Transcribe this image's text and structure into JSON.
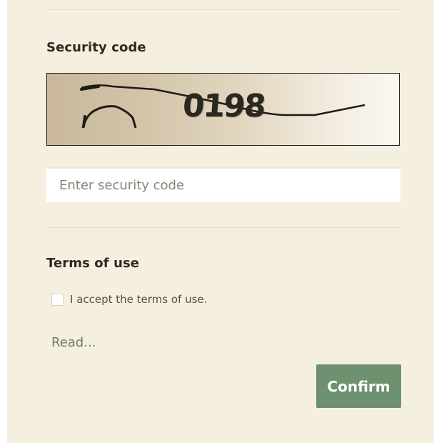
{
  "security": {
    "heading": "Security code",
    "captcha_text": "0198",
    "input_placeholder": "Enter security code",
    "input_value": ""
  },
  "terms": {
    "heading": "Terms of use",
    "checkbox_label": "I accept the terms of use.",
    "checkbox_checked": false,
    "read_link": "Read..."
  },
  "actions": {
    "confirm_label": "Confirm"
  },
  "colors": {
    "panel_background": "#f5efdf",
    "confirm_button": "#6e9270",
    "link": "#6d7f5d"
  }
}
